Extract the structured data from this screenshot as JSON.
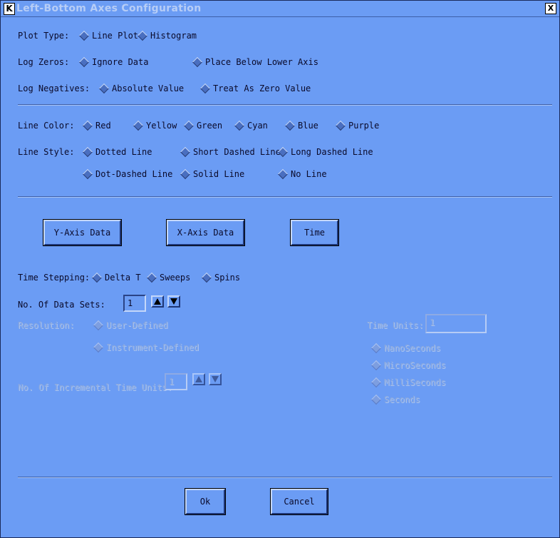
{
  "window": {
    "title": "Left-Bottom Axes Configuration",
    "app_icon": "K",
    "close_glyph": "X"
  },
  "plot_type": {
    "label": "Plot  Type:",
    "options": [
      "Line Plot",
      "Histogram"
    ]
  },
  "log_zeros": {
    "label": "Log Zeros:",
    "options": [
      "Ignore Data",
      "Place Below Lower Axis"
    ]
  },
  "log_negatives": {
    "label": "Log Negatives:",
    "options": [
      "Absolute Value",
      "Treat As Zero Value"
    ]
  },
  "line_color": {
    "label": "Line Color:",
    "options": [
      "Red",
      "Yellow",
      "Green",
      "Cyan",
      "Blue",
      "Purple"
    ]
  },
  "line_style": {
    "label": "Line Style:",
    "options": [
      "Dotted Line",
      "Short Dashed Line",
      "Long Dashed Line",
      "Dot-Dashed Line",
      "Solid Line",
      "No Line"
    ]
  },
  "axis_buttons": {
    "y_axis": "Y-Axis Data",
    "x_axis": "X-Axis Data",
    "time": "Time"
  },
  "time_stepping": {
    "label": "Time Stepping:",
    "options": [
      "Delta T",
      "Sweeps",
      "Spins"
    ]
  },
  "data_sets": {
    "label": "No. Of Data Sets:",
    "value": "1"
  },
  "resolution": {
    "label": "Resolution:",
    "options": [
      "User-Defined",
      "Instrument-Defined"
    ]
  },
  "incremental": {
    "label": "No. Of Incremental Time Units:",
    "value": "1"
  },
  "time_units": {
    "label": "Time Units:",
    "value": "1",
    "options": [
      "NanoSeconds",
      "MicroSeconds",
      "MilliSeconds",
      "Seconds"
    ]
  },
  "footer": {
    "ok": "Ok",
    "cancel": "Cancel"
  }
}
